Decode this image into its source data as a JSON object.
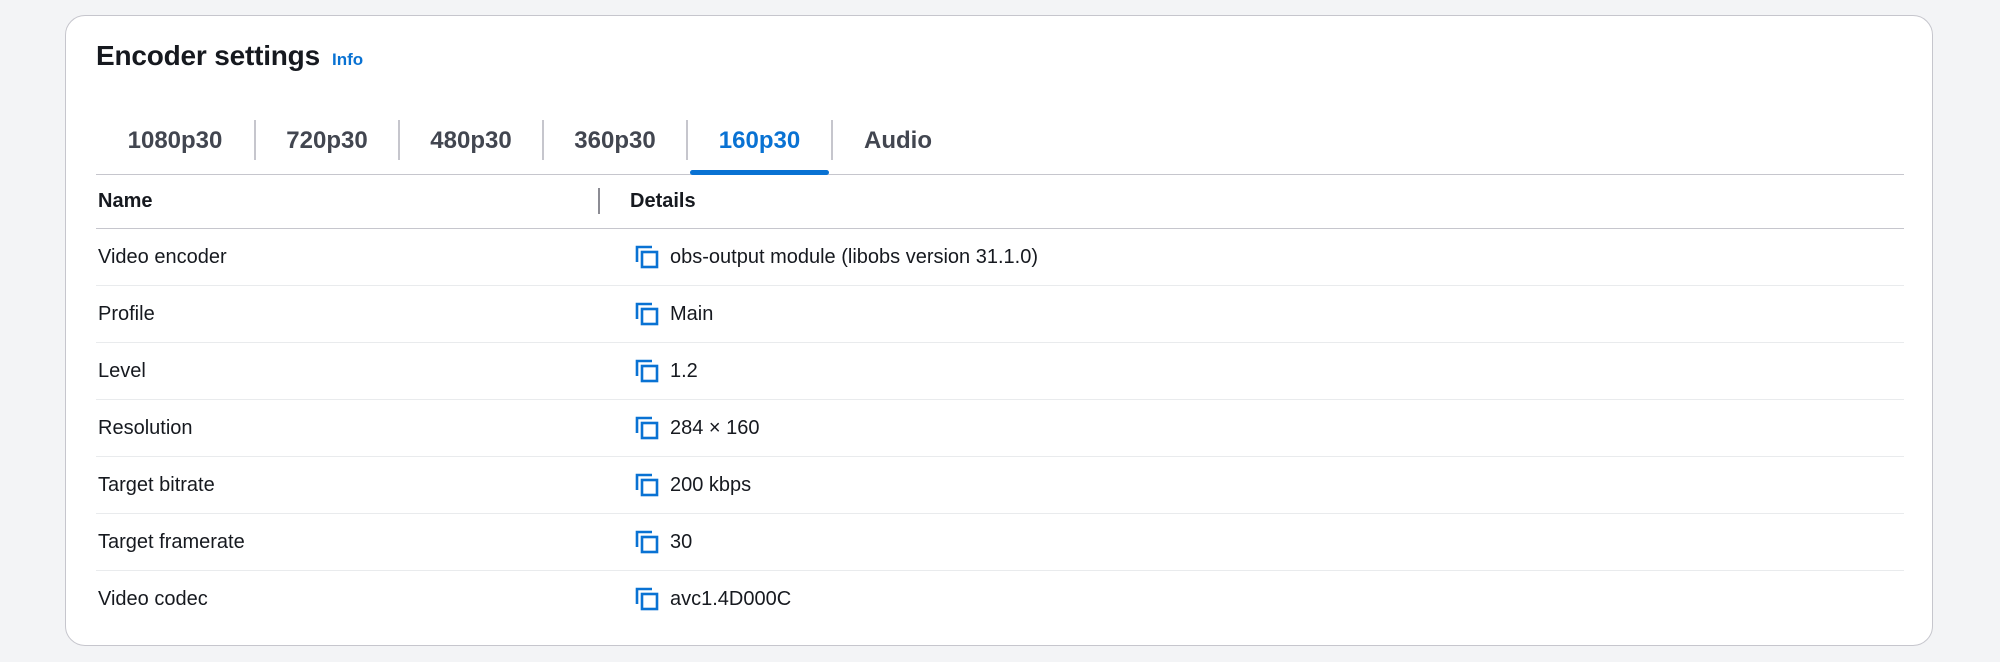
{
  "panel": {
    "title": "Encoder settings",
    "info_label": "Info"
  },
  "tabs": [
    {
      "label": "1080p30",
      "active": false
    },
    {
      "label": "720p30",
      "active": false
    },
    {
      "label": "480p30",
      "active": false
    },
    {
      "label": "360p30",
      "active": false
    },
    {
      "label": "160p30",
      "active": true
    },
    {
      "label": "Audio",
      "active": false
    }
  ],
  "table": {
    "headers": {
      "name": "Name",
      "details": "Details"
    },
    "rows": [
      {
        "name": "Video encoder",
        "details": "obs-output module (libobs version 31.1.0)"
      },
      {
        "name": "Profile",
        "details": "Main"
      },
      {
        "name": "Level",
        "details": "1.2"
      },
      {
        "name": "Resolution",
        "details": "284 × 160"
      },
      {
        "name": "Target bitrate",
        "details": "200 kbps"
      },
      {
        "name": "Target framerate",
        "details": "30"
      },
      {
        "name": "Video codec",
        "details": "avc1.4D000C"
      }
    ]
  },
  "icons": {
    "copy": "copy-icon"
  },
  "colors": {
    "accent": "#0972d3",
    "text": "#16191f",
    "border": "#c6c6cd"
  }
}
